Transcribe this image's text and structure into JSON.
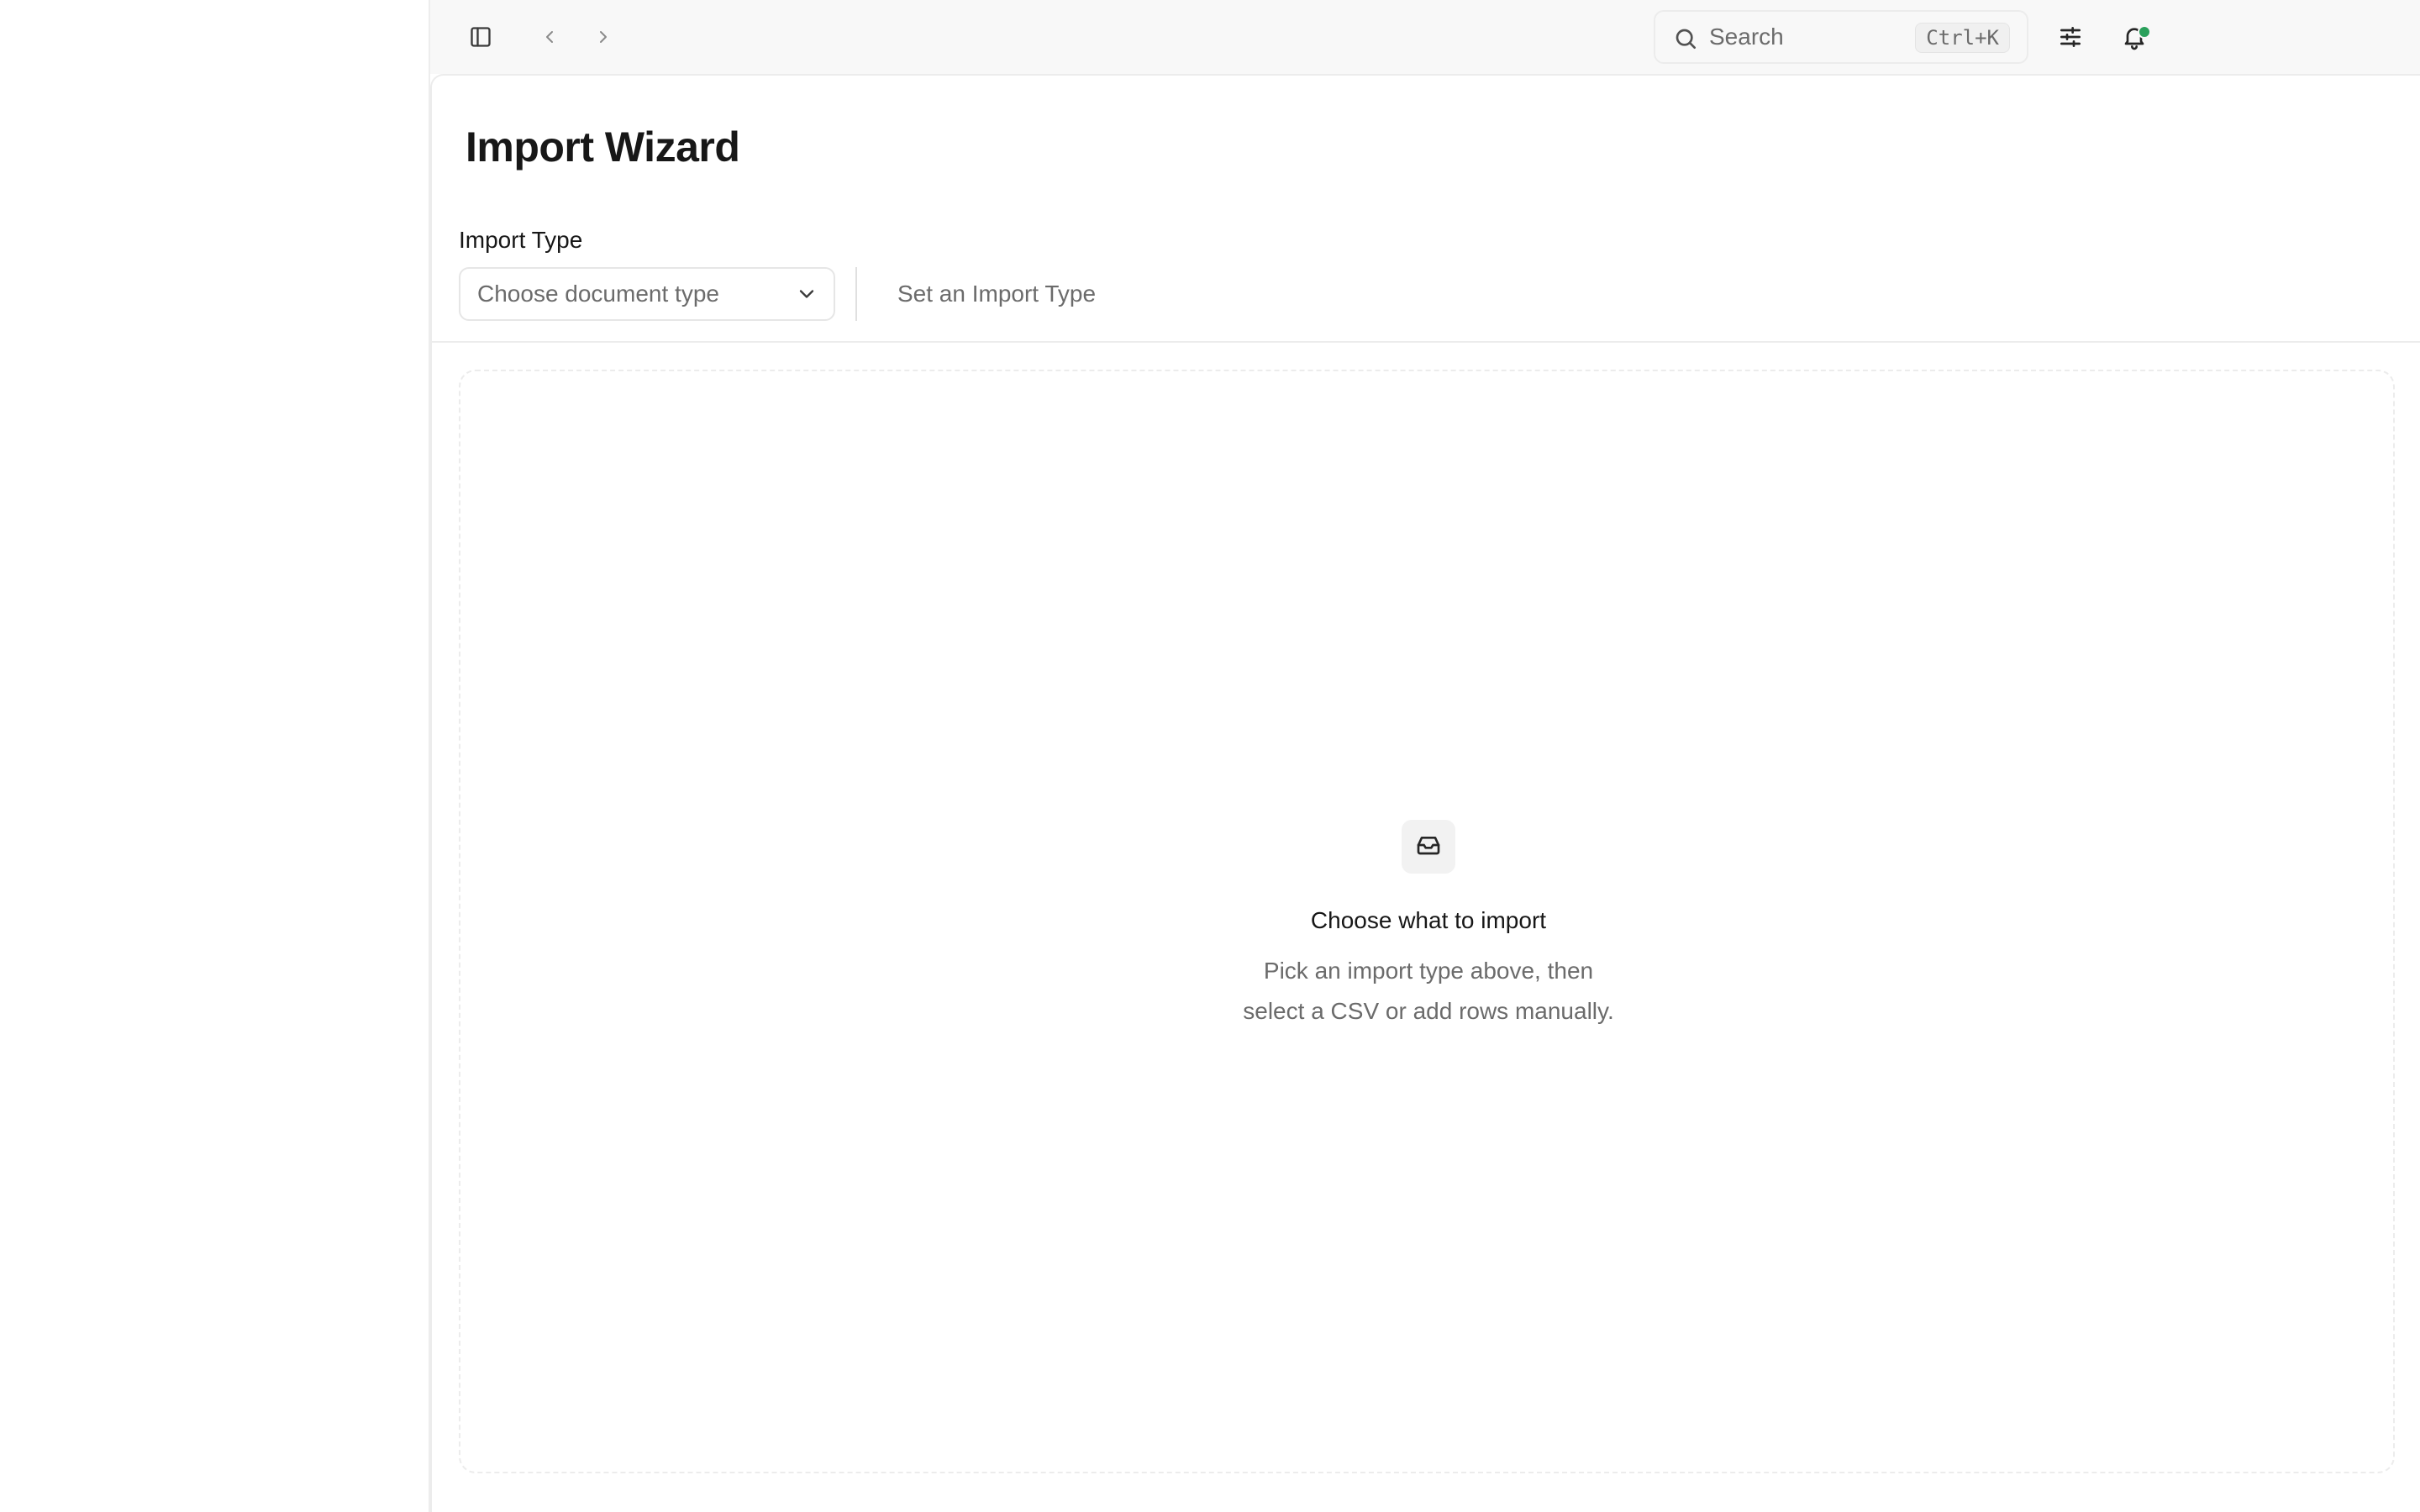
{
  "topbar": {
    "search": {
      "label": "Search",
      "shortcut": "Ctrl+K"
    },
    "icons": {
      "sidebar_toggle": "sidebar-toggle-icon",
      "back": "chevron-left-icon",
      "forward": "chevron-right-icon",
      "search": "search-icon",
      "filters": "sliders-icon",
      "notifications": "bell-icon"
    },
    "notification_dot_color": "#2aa05b"
  },
  "page": {
    "title": "Import Wizard"
  },
  "import_form": {
    "label": "Import Type",
    "select": {
      "placeholder": "Choose document type",
      "icon": "chevron-down-icon"
    },
    "status": "Set an Import Type"
  },
  "empty_state": {
    "icon": "inbox-icon",
    "title": "Choose what to import",
    "description_lines": [
      "Pick an import type above, then",
      "select a CSV or add rows manually."
    ]
  }
}
